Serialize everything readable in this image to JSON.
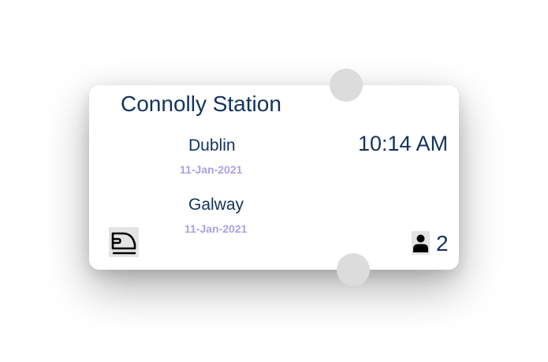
{
  "ticket": {
    "station": "Connolly Station",
    "origin": {
      "city": "Dublin",
      "date": "11-Jan-2021"
    },
    "destination": {
      "city": "Galway",
      "date": "11-Jan-2021"
    },
    "time": "10:14 AM",
    "passengers": "2",
    "transport_icon": "train-icon",
    "passenger_icon": "person-icon"
  }
}
